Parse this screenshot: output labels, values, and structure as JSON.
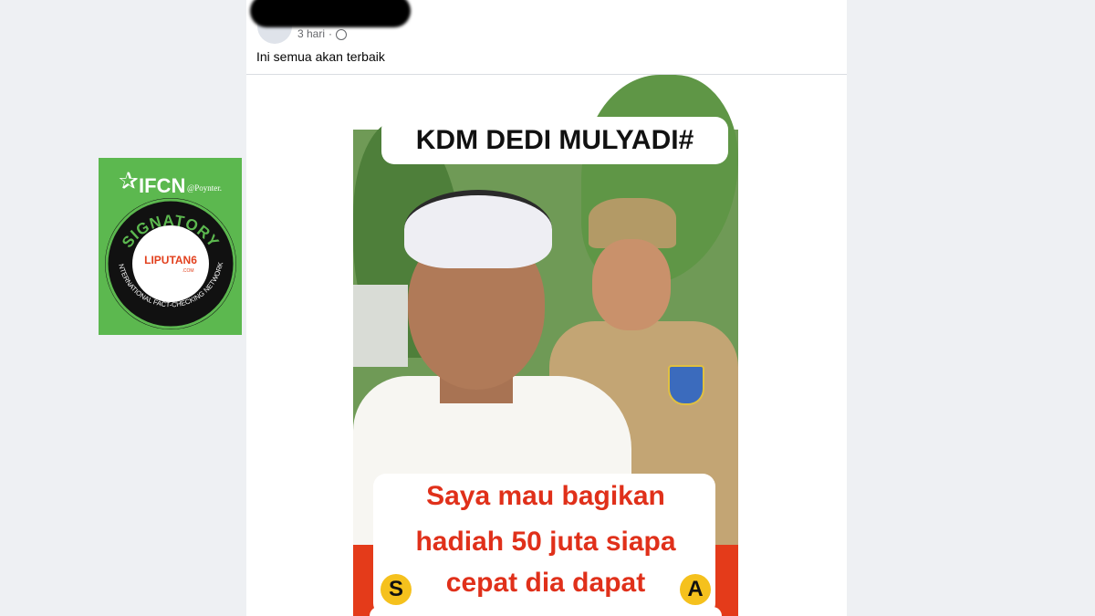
{
  "post": {
    "time": "3 hari",
    "separator": "·",
    "caption": "Ini semua akan terbaik"
  },
  "image": {
    "title": "KDM DEDI MULYADI#",
    "line1": "Saya mau bagikan",
    "line2": "hadiah 50 juta siapa",
    "line3": "cepat dia dapat",
    "coin_left": "S",
    "coin_right": "A"
  },
  "ifcn_badge": {
    "logo": "IFCN",
    "poynter": "@Poynter.",
    "signatory": "SIGNATORY",
    "network": "INTERNATIONAL FACT-CHECKING NETWORK",
    "member": "LIPUTAN6",
    "member_sub": ".COM"
  },
  "colors": {
    "page_bg": "#eef0f3",
    "accent_red": "#e0301a",
    "ifcn_green": "#5cb84f"
  }
}
